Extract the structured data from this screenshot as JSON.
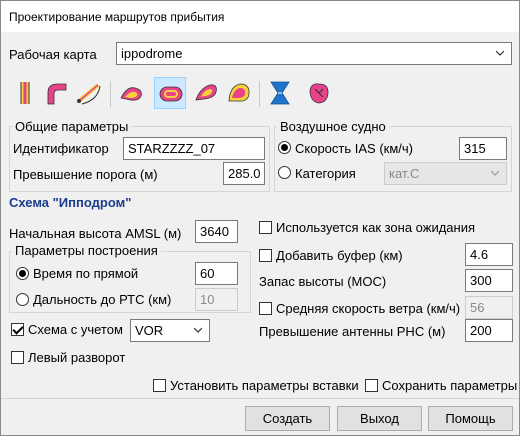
{
  "window": {
    "title": "Проектирование маршрутов прибытия"
  },
  "workmap": {
    "label": "Рабочая карта",
    "value": "ippodrome"
  },
  "toolbar": {
    "tools": [
      "straight-segment-icon",
      "arc-turn-icon",
      "dme-arc-icon",
      "teardrop-icon",
      "racetrack-icon",
      "base-turn-icon",
      "procedure-turn-icon",
      "tacan-icon",
      "holding-reversal-icon"
    ],
    "active_tool": "racetrack-icon"
  },
  "general": {
    "title": "Общие параметры",
    "id_label": "Идентификатор",
    "id_value": "STARZZZZ_07",
    "threshold_label": "Превышение порога (м)",
    "threshold_value": "285.0"
  },
  "aircraft": {
    "title": "Воздушное судно",
    "ias_label": "Скорость IAS (км/ч)",
    "ias_value": "315",
    "category_label": "Категория",
    "category_value": "кат.С"
  },
  "scheme": {
    "title": "Схема \"Ипподром\"",
    "amsl_label": "Начальная высота AMSL (м)",
    "amsl_value": "3640",
    "build_title": "Параметры построения",
    "time_label": "Время по прямой",
    "time_value": "60",
    "range_label": "Дальность до РТС (км)",
    "range_value": "10",
    "scheme_with_label": "Схема с учетом",
    "scheme_with_value": "VOR",
    "left_turn_label": "Левый разворот",
    "holding_label": "Используется как зона ожидания",
    "buffer_label": "Добавить буфер (км)",
    "buffer_value": "4.6",
    "moc_label": "Запас высоты (МОС)",
    "moc_value": "300",
    "wind_label": "Средняя скорость ветра (км/ч)",
    "wind_value": "56",
    "antenna_label": "Превышение антенны РНС (м)",
    "antenna_value": "200"
  },
  "footer": {
    "insert_params_label": "Установить параметры вставки",
    "save_params_label": "Сохранить параметры",
    "create_label": "Создать",
    "exit_label": "Выход",
    "help_label": "Помощь"
  },
  "colors": {
    "section_title": "#1a3d8f",
    "tool_pink": "#e8438a",
    "tool_yellow": "#f5d23a",
    "tool_blue": "#1e74c8",
    "active_tool_bg": "#cce8ff"
  }
}
